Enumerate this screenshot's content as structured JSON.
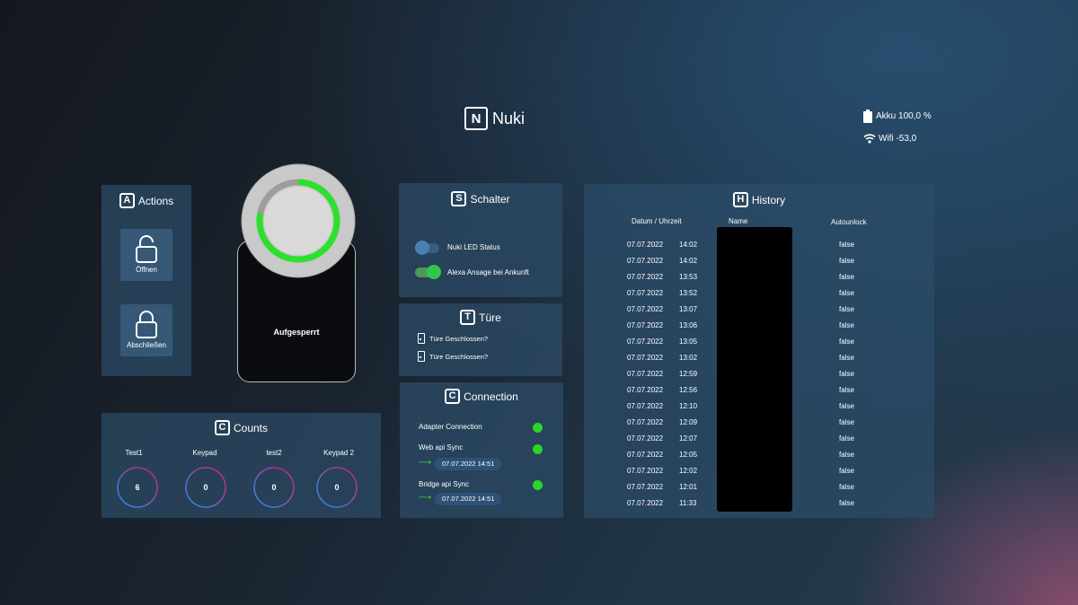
{
  "header": {
    "brand_letter": "N",
    "brand_title": "Nuki",
    "battery": "Akku 100,0 %",
    "wifi": "Wifi -53,0"
  },
  "actions": {
    "letter": "A",
    "title": "Actions",
    "open_label": "Öffnen",
    "lock_label": "Abschließen"
  },
  "lock": {
    "state": "Aufgesperrt",
    "ring_color": "#2ee02e",
    "ring_fill": 0.78
  },
  "schalter": {
    "letter": "S",
    "title": "Schalter",
    "toggles": [
      {
        "label": "Nuki LED Status",
        "on": false
      },
      {
        "label": "Alexa Ansage bei Ankunft",
        "on": true
      }
    ]
  },
  "tuere": {
    "letter": "T",
    "title": "Türe",
    "items": [
      "Türe Geschlossen?",
      "Türe Geschlossen?"
    ]
  },
  "connection": {
    "letter": "C",
    "title": "Connection",
    "adapter_label": "Adapter Connection",
    "web_label": "Web api Sync",
    "web_ts": "07.07.2022 14:51",
    "bridge_label": "Bridge api Sync",
    "bridge_ts": "07.07.2022 14:51",
    "status_color": "#2bd52b"
  },
  "counts": {
    "letter": "C",
    "title": "Counts",
    "items": [
      {
        "label": "Test1",
        "value": "6"
      },
      {
        "label": "Keypad",
        "value": "0"
      },
      {
        "label": "test2",
        "value": "0"
      },
      {
        "label": "Keypad 2",
        "value": "0"
      }
    ]
  },
  "history": {
    "letter": "H",
    "title": "History",
    "col_date": "Datum / Uhrzeit",
    "col_name": "Name",
    "col_autounlock": "Autounlock",
    "rows": [
      {
        "date": "07.07.2022",
        "time": "14:02",
        "autounlock": "false"
      },
      {
        "date": "07.07.2022",
        "time": "14:02",
        "autounlock": "false"
      },
      {
        "date": "07.07.2022",
        "time": "13:53",
        "autounlock": "false"
      },
      {
        "date": "07.07.2022",
        "time": "13:52",
        "autounlock": "false"
      },
      {
        "date": "07.07.2022",
        "time": "13:07",
        "autounlock": "false"
      },
      {
        "date": "07.07.2022",
        "time": "13:06",
        "autounlock": "false"
      },
      {
        "date": "07.07.2022",
        "time": "13:05",
        "autounlock": "false"
      },
      {
        "date": "07.07.2022",
        "time": "13:02",
        "autounlock": "false"
      },
      {
        "date": "07.07.2022",
        "time": "12:59",
        "autounlock": "false"
      },
      {
        "date": "07.07.2022",
        "time": "12:56",
        "autounlock": "false"
      },
      {
        "date": "07.07.2022",
        "time": "12:10",
        "autounlock": "false"
      },
      {
        "date": "07.07.2022",
        "time": "12:09",
        "autounlock": "false"
      },
      {
        "date": "07.07.2022",
        "time": "12:07",
        "autounlock": "false"
      },
      {
        "date": "07.07.2022",
        "time": "12:05",
        "autounlock": "false"
      },
      {
        "date": "07.07.2022",
        "time": "12:02",
        "autounlock": "false"
      },
      {
        "date": "07.07.2022",
        "time": "12:01",
        "autounlock": "false"
      },
      {
        "date": "07.07.2022",
        "time": "11:33",
        "autounlock": "false"
      }
    ]
  }
}
